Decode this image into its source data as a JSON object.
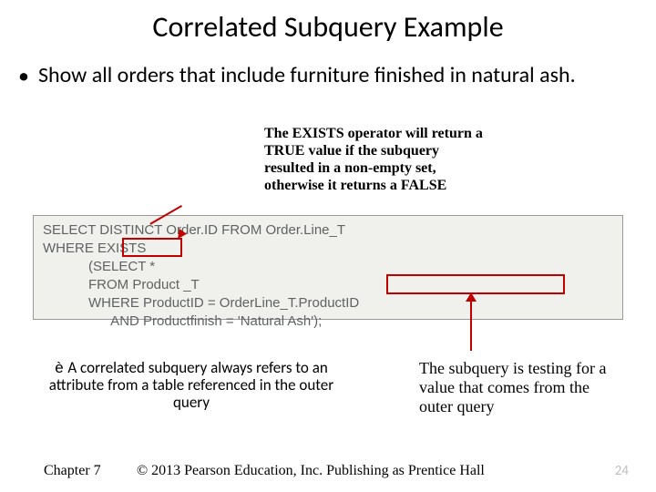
{
  "title": "Correlated Subquery Example",
  "bullet": "Show all orders that include furniture finished in natural ash.",
  "exists_note": "The EXISTS operator will return a TRUE value if the subquery resulted in a non-empty set, otherwise it returns a FALSE",
  "sql": "SELECT DISTINCT Order.ID FROM Order.Line_T\nWHERE EXISTS\n            (SELECT *\n            FROM Product _T\n            WHERE ProductID = OrderLine_T.ProductID\n                  AND Productfinish = 'Natural Ash');",
  "corr_note_prefix": "è ",
  "corr_note": "A correlated subquery always refers to an attribute from a table referenced in the outer query",
  "outer_note": "The subquery is testing for a value that comes from the outer query",
  "footer_chapter": "Chapter 7",
  "footer_copy": "© 2013 Pearson Education, Inc.  Publishing as Prentice Hall",
  "footer_page": "24"
}
